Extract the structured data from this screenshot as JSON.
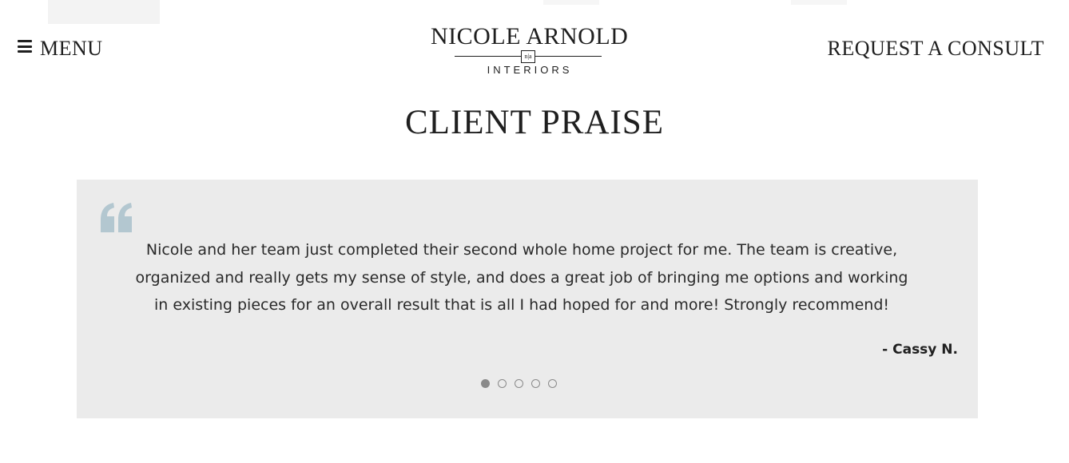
{
  "header": {
    "menu_label": "MENU",
    "consult_label": "REQUEST A CONSULT",
    "logo": {
      "name": "NICOLE ARNOLD",
      "monogram": "n|a",
      "subtitle": "INTERIORS"
    }
  },
  "section": {
    "title": "CLIENT PRAISE"
  },
  "testimonial": {
    "quote_color": "#b3c7d0",
    "box_color": "#ebebeb",
    "text": "Nicole and her team just completed their second whole home project for me. The team is creative, organized and really gets my sense of style, and does a great job of bringing me options and working in existing pieces for an overall result that is all I had hoped for and more! Strongly recommend!",
    "author": "- Cassy N.",
    "slider": {
      "total": 5,
      "active_index": 0
    }
  },
  "icons": {
    "menu": "hamburger-icon",
    "quote": "quote-icon"
  }
}
